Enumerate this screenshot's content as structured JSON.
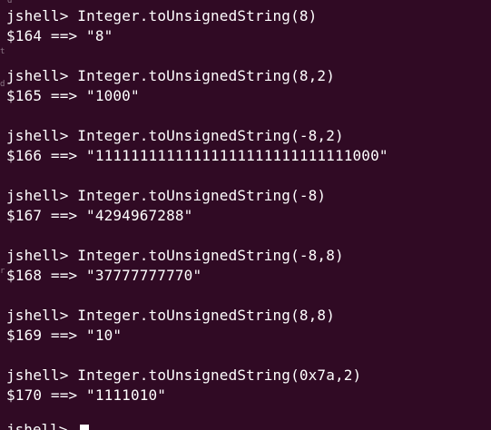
{
  "terminal": {
    "top_fragment": "d",
    "left_artifacts": [
      "t",
      "d",
      "r"
    ],
    "entries": [
      {
        "prompt": "jshell>",
        "command": "Integer.toUnsignedString(8)",
        "result": "$164 ==> \"8\""
      },
      {
        "prompt": "jshell>",
        "command": "Integer.toUnsignedString(8,2)",
        "result": "$165 ==> \"1000\""
      },
      {
        "prompt": "jshell>",
        "command": "Integer.toUnsignedString(-8,2)",
        "result": "$166 ==> \"11111111111111111111111111111000\""
      },
      {
        "prompt": "jshell>",
        "command": "Integer.toUnsignedString(-8)",
        "result": "$167 ==> \"4294967288\""
      },
      {
        "prompt": "jshell>",
        "command": "Integer.toUnsignedString(-8,8)",
        "result": "$168 ==> \"37777777770\""
      },
      {
        "prompt": "jshell>",
        "command": "Integer.toUnsignedString(8,8)",
        "result": "$169 ==> \"10\""
      },
      {
        "prompt": "jshell>",
        "command": "Integer.toUnsignedString(0x7a,2)",
        "result": "$170 ==> \"1111010\""
      }
    ],
    "current_prompt": "jshell>"
  }
}
